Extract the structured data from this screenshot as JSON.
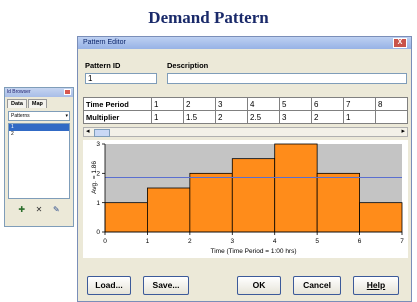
{
  "slide": {
    "title": "Demand Pattern"
  },
  "browser": {
    "title": "ld Browser",
    "tabs": [
      "Data",
      "Map"
    ],
    "dropdown": "Patterns",
    "items": [
      "1",
      "2"
    ],
    "selected": "1",
    "icons": [
      "add-icon",
      "delete-icon",
      "edit-icon"
    ]
  },
  "editor": {
    "title": "Pattern Editor",
    "close_label": "X",
    "pattern_id_label": "Pattern ID",
    "pattern_id_value": "1",
    "description_label": "Description",
    "description_value": "",
    "time_period_label": "Time Period",
    "multiplier_label": "Multiplier",
    "periods": [
      "1",
      "2",
      "3",
      "4",
      "5",
      "6",
      "7",
      "8"
    ],
    "multipliers": [
      "1",
      "1.5",
      "2",
      "2.5",
      "3",
      "2",
      "1",
      ""
    ],
    "buttons": {
      "load": "Load...",
      "save": "Save...",
      "ok": "OK",
      "cancel": "Cancel",
      "help": "Help"
    }
  },
  "chart_data": {
    "type": "bar",
    "x": [
      0,
      1,
      2,
      3,
      4,
      5,
      6
    ],
    "values": [
      1,
      1.5,
      2,
      2.5,
      3,
      2,
      1
    ],
    "average": 1.86,
    "avg_label": "Avg. = 1.86",
    "xlabel": "Time (Time Period = 1:00 hrs)",
    "xlim": [
      0,
      7
    ],
    "ylim": [
      0,
      3
    ],
    "xticks": [
      "0",
      "1",
      "2",
      "3",
      "4",
      "5",
      "6",
      "7"
    ],
    "yticks": [
      "0",
      "1",
      "2",
      "3"
    ],
    "bar_color": "#ff8c1a",
    "avg_line_color": "#5a6fd0",
    "plot_bg": "#c4c4c4"
  }
}
